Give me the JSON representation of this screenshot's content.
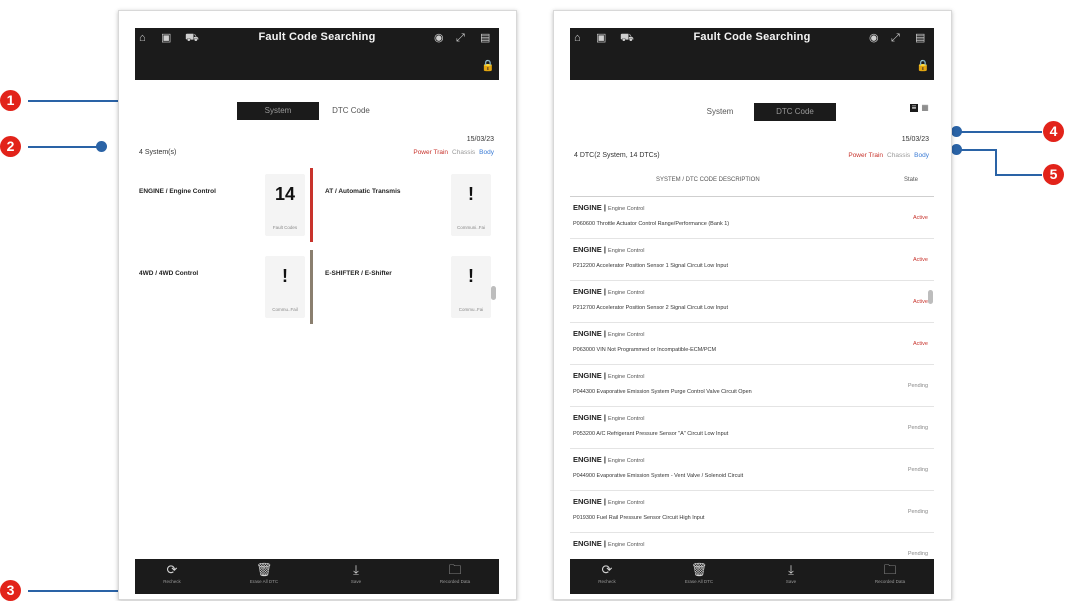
{
  "left": {
    "title": "Fault Code Searching",
    "tabs": {
      "system": "System",
      "dtc": "DTC Code"
    },
    "date": "15/03/23",
    "summary": "4 System(s)",
    "filters": {
      "power": "Power Train",
      "chassis": "Chassis",
      "body": "Body"
    },
    "tiles": [
      {
        "name": "ENGINE / Engine Control",
        "big": "14",
        "sub": "Fault Codes",
        "stripe": "#c8332c"
      },
      {
        "name": "AT / Automatic Transmis",
        "big": "!",
        "sub": "Communi..Fai",
        "stripe": "#c8332c"
      },
      {
        "name": "4WD / 4WD Control",
        "big": "!",
        "sub": "Commu..Fail",
        "stripe": "#8a7f6f"
      },
      {
        "name": "E-SHIFTER / E-Shifter",
        "big": "!",
        "sub": "Commu..Fai",
        "stripe": "#8a7f6f"
      }
    ],
    "bottom": [
      "Recheck",
      "Erase All DTC",
      "Save",
      "Recorded Data"
    ]
  },
  "right": {
    "title": "Fault Code Searching",
    "tabs": {
      "system": "System",
      "dtc": "DTC Code"
    },
    "date": "15/03/23",
    "summary": "4 DTC(2 System, 14 DTCs)",
    "filters": {
      "power": "Power Train",
      "chassis": "Chassis",
      "body": "Body"
    },
    "header": {
      "left": "SYSTEM / DTC CODE DESCRIPTION",
      "right": "State"
    },
    "rows": [
      {
        "sys": "ENGINE",
        "sysdesc": "Engine Control",
        "code": "P060600 Throttle Actuator Control Range/Performance (Bank 1)",
        "status": "Active",
        "kind": "active"
      },
      {
        "sys": "ENGINE",
        "sysdesc": "Engine Control",
        "code": "P212200 Accelerator Position Sensor 1 Signal Circuit Low Input",
        "status": "Active",
        "kind": "active"
      },
      {
        "sys": "ENGINE",
        "sysdesc": "Engine Control",
        "code": "P212700 Accelerator Position Sensor 2 Signal Circuit Low Input",
        "status": "Active",
        "kind": "active"
      },
      {
        "sys": "ENGINE",
        "sysdesc": "Engine Control",
        "code": "P063000 VIN Not Programmed or Incompatible-ECM/PCM",
        "status": "Active",
        "kind": "active"
      },
      {
        "sys": "ENGINE",
        "sysdesc": "Engine Control",
        "code": "P044300 Evaporative Emission System Purge Control Valve Circuit Open",
        "status": "Pending",
        "kind": "pending"
      },
      {
        "sys": "ENGINE",
        "sysdesc": "Engine Control",
        "code": "P053200 A/C Refrigerant Pressure Sensor \"A\" Circuit Low Input",
        "status": "Pending",
        "kind": "pending"
      },
      {
        "sys": "ENGINE",
        "sysdesc": "Engine Control",
        "code": "P044900 Evaporative Emission System - Vent Valve / Solenoid Circuit",
        "status": "Pending",
        "kind": "pending"
      },
      {
        "sys": "ENGINE",
        "sysdesc": "Engine Control",
        "code": "P019300 Fuel Rail Pressure Sensor Circuit High Input",
        "status": "Pending",
        "kind": "pending"
      },
      {
        "sys": "ENGINE",
        "sysdesc": "Engine Control",
        "code": "",
        "status": "Pending",
        "kind": "pending"
      }
    ],
    "bottom": [
      "Recheck",
      "Erase All DTC",
      "Save",
      "Recorded Data"
    ]
  },
  "callouts": [
    "1",
    "2",
    "3",
    "4",
    "5"
  ]
}
